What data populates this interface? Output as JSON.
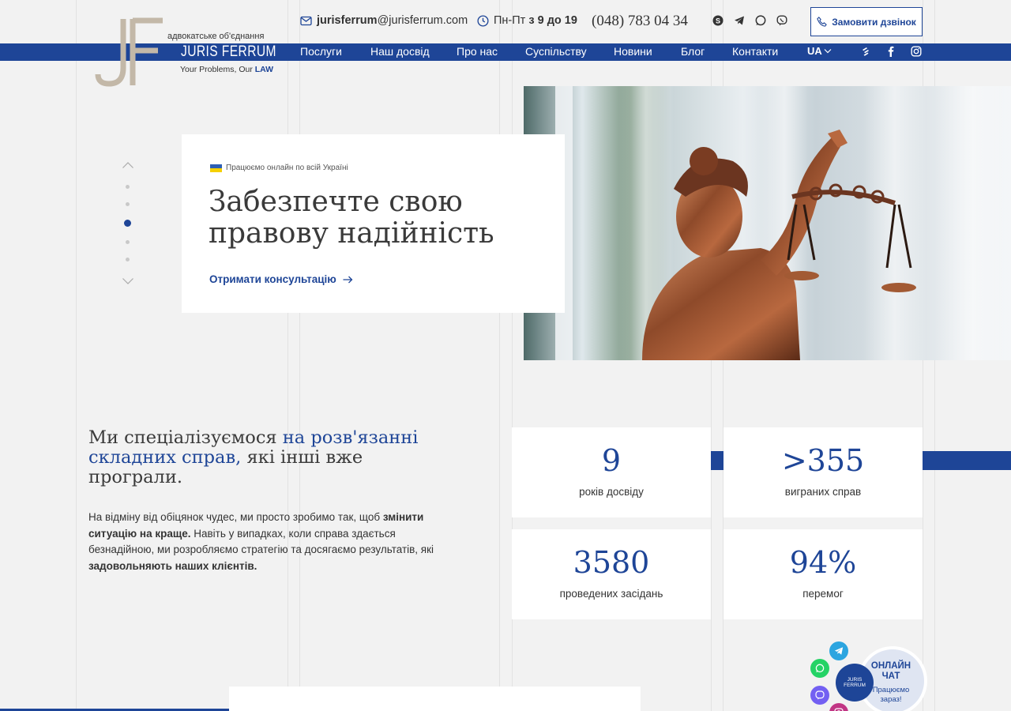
{
  "colors": {
    "brand": "#1e4597",
    "background": "#f2f2f2"
  },
  "header": {
    "logo": {
      "line1": "адвокатське об'єднання",
      "line2": "JURIS FERRUM",
      "tagline_prefix": "Your Problems, Our",
      "tagline_highlight": "LAW"
    },
    "email_user": "jurisferrum",
    "email_domain": "@jurisferrum.com",
    "hours_prefix": "Пн-Пт",
    "hours_value": "з 9 до 19",
    "phone": "(048) 783 04 34",
    "messengers": [
      "skype-icon",
      "telegram-icon",
      "whatsapp-icon",
      "viber-icon"
    ],
    "call_button": "Замовити дзвінок"
  },
  "nav": {
    "items": [
      "Послуги",
      "Наш досвід",
      "Про нас",
      "Суспільству",
      "Новини",
      "Блог",
      "Контакти"
    ],
    "lang": "UA",
    "social": [
      "sitemap-icon",
      "facebook-icon",
      "instagram-icon"
    ]
  },
  "hero": {
    "badge": "Працюємо онлайн по всій Україні",
    "title": "Забезпечте свою правову надійність",
    "cta": "Отримати консультацію",
    "slides_count": 5,
    "active_slide": 3
  },
  "specialization": {
    "title_part1": "Ми спеціалізуємося ",
    "title_highlight": "на розв'язанні складних справ,",
    "title_part2": " які інші вже програли.",
    "text_part1": "На відміну від обіцянок чудес, ми просто зробимо так, щоб ",
    "text_bold1": "змінити ситуацію на краще.",
    "text_part2": " Навіть у випадках, коли справа здається безнадійною, ми розробляємо стратегію та досягаємо результатів, які ",
    "text_bold2": "задовольняють наших клієнтів."
  },
  "stats": [
    {
      "value": "9",
      "label": "років досвіду"
    },
    {
      "value": ">355",
      "label": "виграних справ"
    },
    {
      "value": "3580",
      "label": "проведених засідань"
    },
    {
      "value": "94%",
      "label": "перемог"
    }
  ],
  "chat": {
    "title": "ОНЛАЙН ЧАТ",
    "subtitle": "Працюємо зараз!",
    "logo_text": "JURIS FERRUM",
    "channels": [
      "telegram-icon",
      "whatsapp-icon",
      "viber-icon",
      "instagram-icon"
    ]
  }
}
